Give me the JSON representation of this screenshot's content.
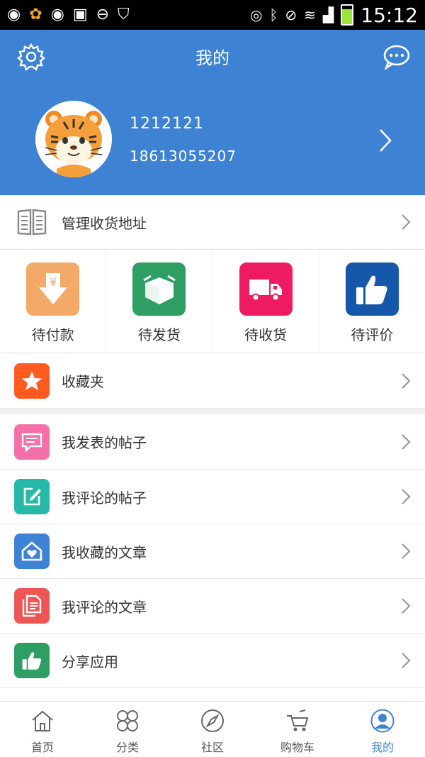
{
  "status_bar": {
    "time": "15:12",
    "icons": [
      "weibo-icon",
      "uc-icon",
      "weibo-icon",
      "image-icon",
      "dnd-icon",
      "shield-icon",
      "eye-icon",
      "bluetooth-icon",
      "mute-icon",
      "wifi-icon",
      "signal-icon",
      "battery-icon"
    ]
  },
  "header": {
    "title": "我的",
    "user_name": "1212121",
    "user_phone": "18613055207",
    "accent": "#3e82d4"
  },
  "address_row": {
    "label": "管理收货地址"
  },
  "orders": [
    {
      "label": "待付款",
      "icon": "yen-down-icon",
      "color": "#f3a967"
    },
    {
      "label": "待发货",
      "icon": "box-icon",
      "color": "#2e9e63"
    },
    {
      "label": "待收货",
      "icon": "truck-icon",
      "color": "#ee1b62"
    },
    {
      "label": "待评价",
      "icon": "thumbs-up-icon",
      "color": "#1557a8"
    }
  ],
  "favorites_row": {
    "label": "收藏夹",
    "icon": "star-icon",
    "color": "#ff5a1f"
  },
  "menu": [
    {
      "label": "我发表的帖子",
      "icon": "message-icon",
      "color": "#f570a9"
    },
    {
      "label": "我评论的帖子",
      "icon": "edit-icon",
      "color": "#27b9a8"
    },
    {
      "label": "我收藏的文章",
      "icon": "house-heart-icon",
      "color": "#3e82d4"
    },
    {
      "label": "我评论的文章",
      "icon": "document-icon",
      "color": "#ee5656"
    },
    {
      "label": "分享应用",
      "icon": "thumbs-up-icon",
      "color": "#2e9e63"
    }
  ],
  "bottom_nav": [
    {
      "label": "首页",
      "icon": "home-icon"
    },
    {
      "label": "分类",
      "icon": "grid-icon"
    },
    {
      "label": "社区",
      "icon": "compass-icon"
    },
    {
      "label": "购物车",
      "icon": "cart-icon"
    },
    {
      "label": "我的",
      "icon": "user-icon",
      "active": true
    }
  ]
}
